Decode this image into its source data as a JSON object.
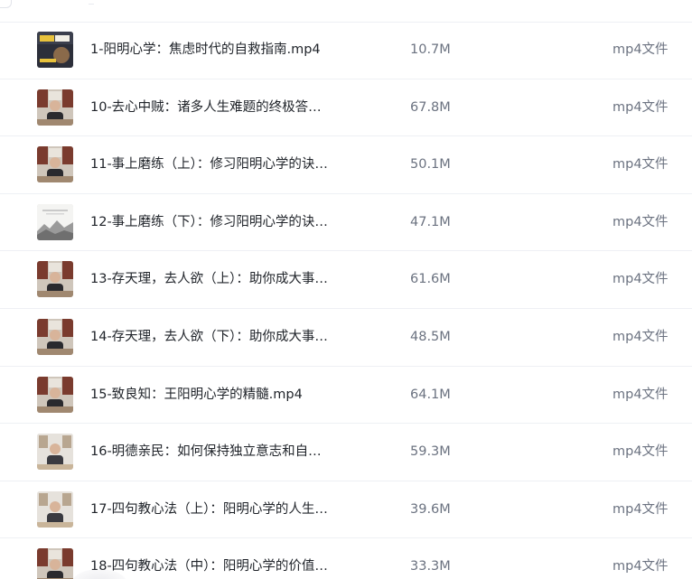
{
  "files": [
    {
      "name": "1-阳明心学：焦虑时代的自救指南.mp4",
      "size": "10.7M",
      "type": "mp4文件",
      "thumb": "cover-icon"
    },
    {
      "name": "10-去心中贼：诸多人生难题的终极答…",
      "size": "67.8M",
      "type": "mp4文件",
      "thumb": "speaker-icon"
    },
    {
      "name": "11-事上磨练（上）：修习阳明心学的诀…",
      "size": "50.1M",
      "type": "mp4文件",
      "thumb": "speaker-icon"
    },
    {
      "name": "12-事上磨练（下）：修习阳明心学的诀…",
      "size": "47.1M",
      "type": "mp4文件",
      "thumb": "landscape-icon"
    },
    {
      "name": "13-存天理，去人欲（上）：助你成大事…",
      "size": "61.6M",
      "type": "mp4文件",
      "thumb": "speaker-icon"
    },
    {
      "name": "14-存天理，去人欲（下）：助你成大事…",
      "size": "48.5M",
      "type": "mp4文件",
      "thumb": "speaker-icon"
    },
    {
      "name": "15-致良知：王阳明心学的精髓.mp4",
      "size": "64.1M",
      "type": "mp4文件",
      "thumb": "speaker-icon"
    },
    {
      "name": "16-明德亲民：如何保持独立意志和自…",
      "size": "59.3M",
      "type": "mp4文件",
      "thumb": "speaker-light-icon"
    },
    {
      "name": "17-四句教心法（上）：阳明心学的人生…",
      "size": "39.6M",
      "type": "mp4文件",
      "thumb": "speaker-light-icon"
    },
    {
      "name": "18-四句教心法（中）：阳明心学的价值…",
      "size": "33.3M",
      "type": "mp4文件",
      "thumb": "speaker-icon"
    }
  ],
  "colors": {
    "text_primary": "#1f2329",
    "text_secondary": "#6b7280",
    "divider": "#eef0f4"
  }
}
